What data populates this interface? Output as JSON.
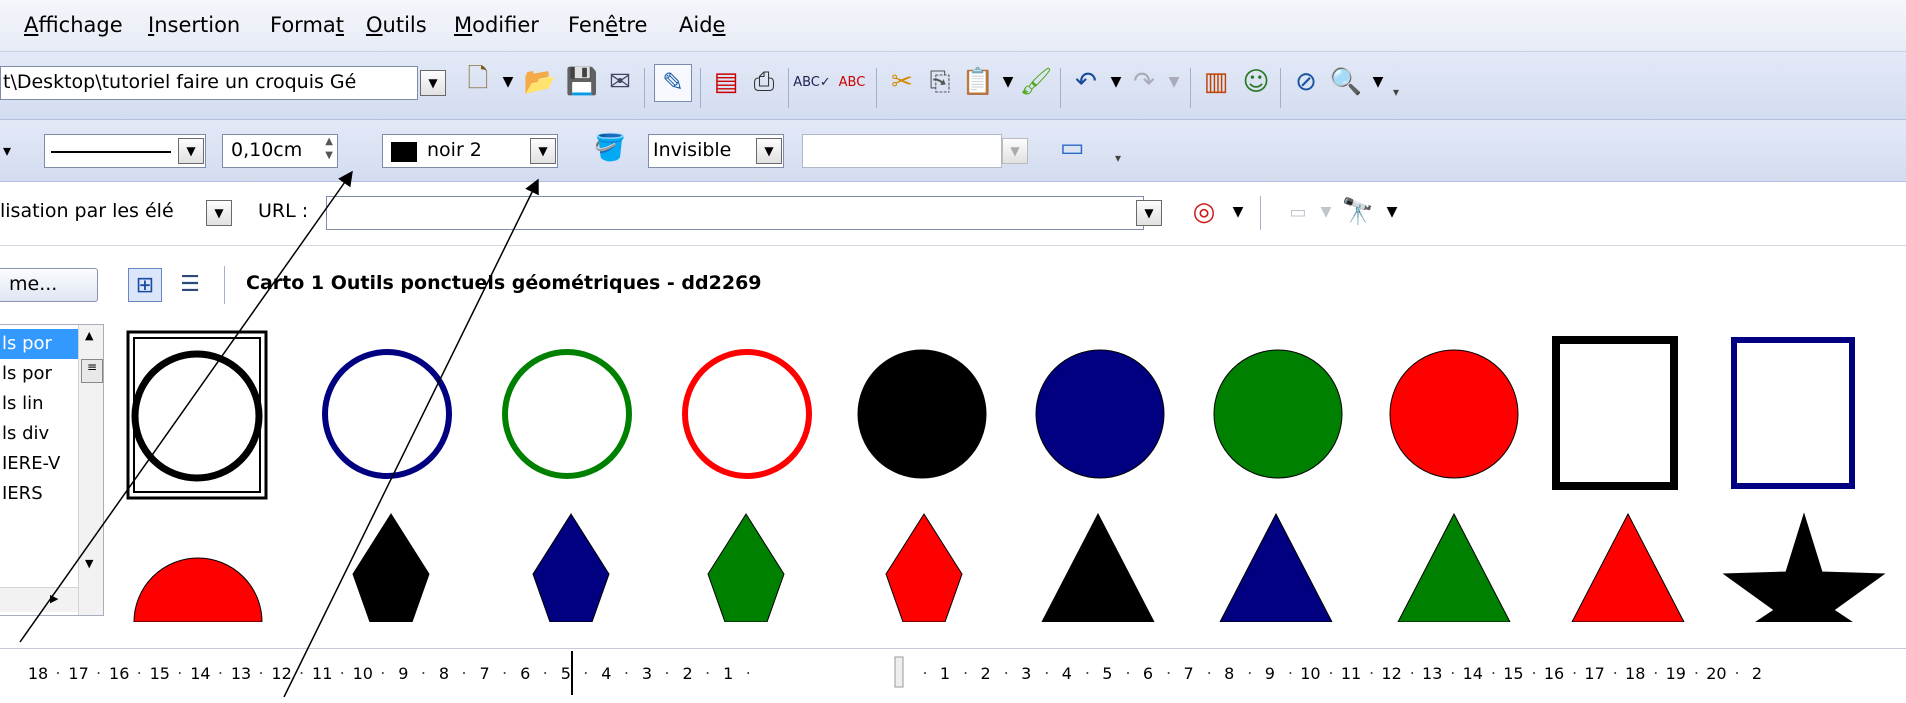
{
  "menu": [
    {
      "label": "Affichage",
      "ul": 0
    },
    {
      "label": "Insertion",
      "ul": 0
    },
    {
      "label": "Format",
      "ul": 5
    },
    {
      "label": "Outils",
      "ul": 0
    },
    {
      "label": "Modifier",
      "ul": 0
    },
    {
      "label": "Fenêtre",
      "ul": 3
    },
    {
      "label": "Aide",
      "ul": 3
    }
  ],
  "toolbar1": {
    "path": "t\\Desktop\\tutoriel faire un croquis Gé"
  },
  "toolbar2": {
    "line_width": "0,10cm",
    "line_color": "noir 2",
    "shadow": "Invisible"
  },
  "toolbar3": {
    "visualisation": "lisation par les élé",
    "url_label": "URL :",
    "url_value": ""
  },
  "gallery": {
    "theme_button": "me...",
    "title": "Carto 1 Outils ponctuels géométriques - dd2269",
    "list_items": [
      "ls por",
      "ls por",
      "ls lin",
      "ls div",
      "IERE-V",
      "IERS"
    ],
    "colors": {
      "black": "#000000",
      "blue": "#000080",
      "green": "#008000",
      "red": "#ff0000",
      "selection": "#3399ff"
    }
  },
  "ruler": {
    "left_ticks": [
      "18",
      "17",
      "16",
      "15",
      "14",
      "13",
      "12",
      "11",
      "10",
      "9",
      "8",
      "7",
      "6",
      "5",
      "4",
      "3",
      "2",
      "1"
    ],
    "right_ticks": [
      "1",
      "2",
      "3",
      "4",
      "5",
      "6",
      "7",
      "8",
      "9",
      "10",
      "11",
      "12",
      "13",
      "14",
      "15",
      "16",
      "17",
      "18",
      "19",
      "20",
      "2"
    ]
  }
}
